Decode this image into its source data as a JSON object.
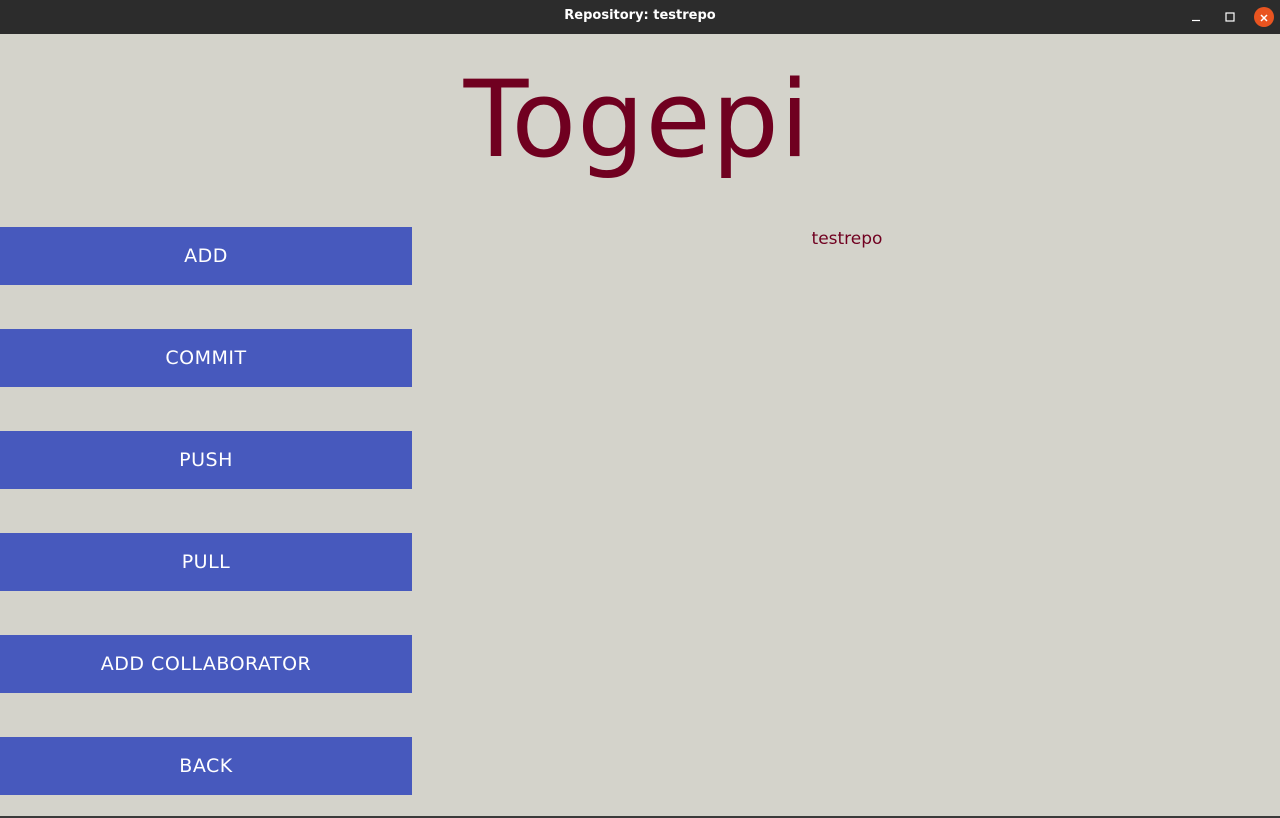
{
  "window": {
    "title": "Repository: testrepo",
    "controls": {
      "minimize_icon": "minimize-icon",
      "maximize_icon": "maximize-icon",
      "close_icon": "close-icon"
    }
  },
  "app": {
    "title": "Togepi"
  },
  "buttons": [
    {
      "label": "ADD"
    },
    {
      "label": "COMMIT"
    },
    {
      "label": "PUSH"
    },
    {
      "label": "PULL"
    },
    {
      "label": "ADD COLLABORATOR"
    },
    {
      "label": "BACK"
    }
  ],
  "repository": {
    "name": "testrepo"
  },
  "colors": {
    "background": "#d4d3cb",
    "titlebar": "#2c2c2c",
    "accent_text": "#700020",
    "button_bg": "#4759bd",
    "button_text": "#ffffff",
    "close_button": "#e95420"
  }
}
